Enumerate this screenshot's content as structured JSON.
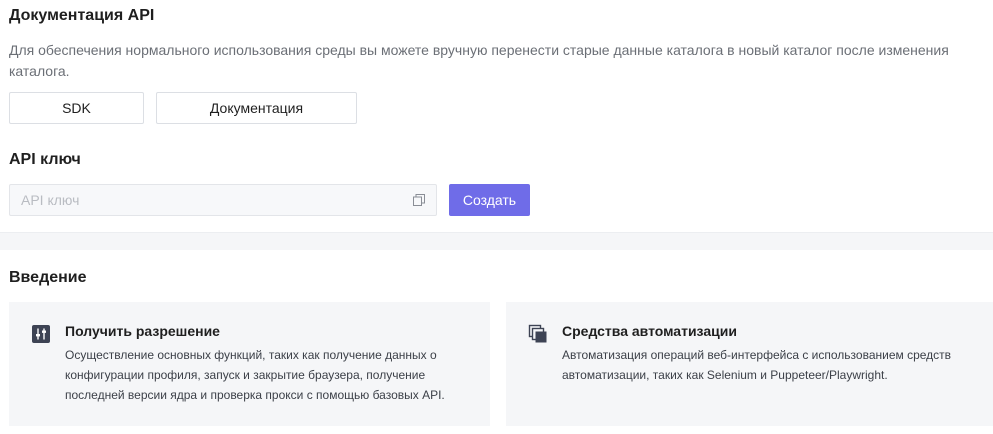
{
  "documentation": {
    "title": "Документация API",
    "description": "Для обеспечения нормального использования среды вы можете вручную перенести старые данные каталога в новый каталог после изменения каталога.",
    "sdk_button": "SDK",
    "docs_button": "Документация"
  },
  "api_key": {
    "title": "API ключ",
    "placeholder": "API ключ",
    "value": "",
    "create_button": "Создать",
    "icon": "copy-icon"
  },
  "intro": {
    "title": "Введение",
    "cards": [
      {
        "icon": "sliders-icon",
        "title": "Получить разрешение",
        "text": "Осуществление основных функций, таких как получение данных о конфигурации профиля, запуск и закрытие браузера, получение последней версии ядра и проверка прокси с помощью базовых API."
      },
      {
        "icon": "windows-stack-icon",
        "title": "Средства автоматизации",
        "text": "Автоматизация операций веб-интерфейса с использованием средств автоматизации, таких как Selenium и Puppeteer/Playwright."
      }
    ]
  },
  "colors": {
    "accent": "#6f6ce8",
    "card_bg": "#f5f6f8",
    "muted_text": "#6b6f76",
    "icon_dark": "#3d4354"
  }
}
